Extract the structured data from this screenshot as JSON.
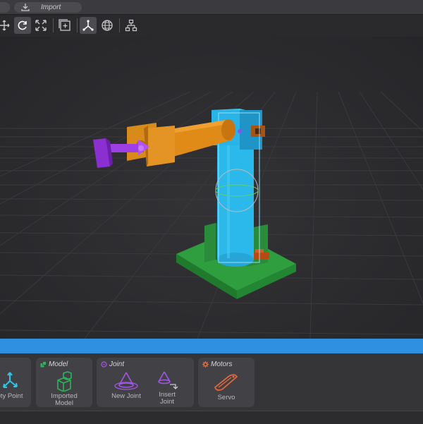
{
  "topbar": {
    "import_label": "Import"
  },
  "toolbar": {
    "tools": [
      "move",
      "rotate",
      "scale",
      "add-frame",
      "local-axes",
      "world-globe",
      "hierarchy"
    ]
  },
  "colors": {
    "accent_blue": "#2f8fe0",
    "model_green": "#2db35b",
    "joint_purple": "#a355e8",
    "motor_orange": "#e8683a",
    "point_cyan": "#2ec6e6"
  },
  "palette": {
    "point": {
      "tool_label": "pty Point"
    },
    "model": {
      "header": "Model",
      "tool_label": "Imported Model"
    },
    "joint": {
      "header": "Joint",
      "new_joint": "New Joint",
      "insert_joint": "Insert Joint"
    },
    "motors": {
      "header": "Motors",
      "servo": "Servo"
    }
  }
}
